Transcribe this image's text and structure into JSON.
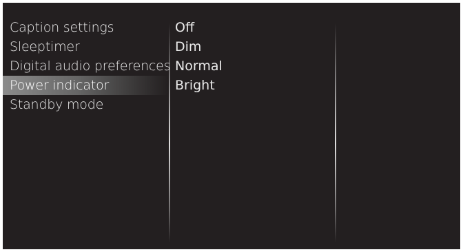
{
  "menu": {
    "items": [
      {
        "label": "Caption settings"
      },
      {
        "label": "Sleeptimer"
      },
      {
        "label": "Digital audio preferences"
      },
      {
        "label": "Power indicator",
        "selected": true
      },
      {
        "label": "Standby mode"
      }
    ]
  },
  "options": {
    "items": [
      {
        "label": "Off"
      },
      {
        "label": "Dim"
      },
      {
        "label": "Normal"
      },
      {
        "label": "Bright"
      }
    ]
  },
  "colors": {
    "background": "#231f20",
    "text": "#e9e9e9",
    "highlight": "#8c8c8c"
  }
}
